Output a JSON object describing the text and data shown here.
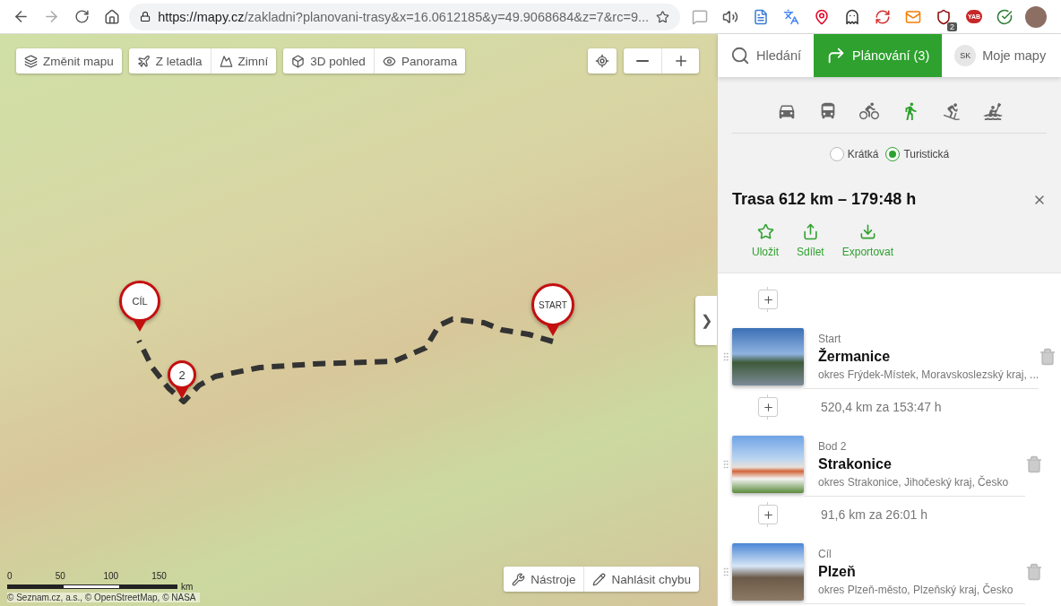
{
  "browser": {
    "url_host": "https://mapy.cz",
    "url_path": "/zakladni?planovani-trasy&x=16.0612185&y=49.9068684&z=7&rc=9...",
    "extensions": [
      {
        "kind": "chat"
      },
      {
        "kind": "speaker"
      },
      {
        "kind": "note"
      },
      {
        "kind": "translate"
      },
      {
        "kind": "pin"
      },
      {
        "kind": "ghost"
      },
      {
        "kind": "sync"
      },
      {
        "kind": "mail"
      },
      {
        "kind": "shield",
        "badge": "2"
      },
      {
        "kind": "tag",
        "text": "YAB"
      },
      {
        "kind": "check"
      }
    ]
  },
  "map": {
    "toolbar": [
      [
        {
          "kind": "layers",
          "label": "Změnit mapu"
        }
      ],
      [
        {
          "kind": "plane",
          "label": "Z letadla"
        },
        {
          "kind": "mountain",
          "label": "Zimní"
        }
      ],
      [
        {
          "kind": "cube",
          "label": "3D pohled"
        },
        {
          "kind": "eye",
          "label": "Panorama"
        }
      ]
    ],
    "markers": [
      {
        "kind": "end",
        "label": "CÍL"
      },
      {
        "kind": "via",
        "label": "2"
      },
      {
        "kind": "start",
        "label": "START"
      }
    ],
    "scale": {
      "ticks": [
        "0",
        "50",
        "100",
        "150"
      ],
      "unit": "km"
    },
    "attribution": "© Seznam.cz, a.s., © OpenStreetMap, © NASA",
    "bottom_buttons": [
      {
        "kind": "tools",
        "label": "Nástroje"
      },
      {
        "kind": "pencil",
        "label": "Nahlásit chybu"
      }
    ],
    "panel_toggle": "❯"
  },
  "panel": {
    "tabs": [
      {
        "kind": "search",
        "label": "Hledání",
        "selected": false
      },
      {
        "kind": "route",
        "label": "Plánování (3)",
        "selected": true
      },
      {
        "kind": "user",
        "avatar": "SK",
        "label": "Moje mapy",
        "selected": false
      }
    ],
    "modes": [
      {
        "kind": "car",
        "selected": false
      },
      {
        "kind": "bus",
        "selected": false
      },
      {
        "kind": "bike",
        "selected": false
      },
      {
        "kind": "walk",
        "selected": true
      },
      {
        "kind": "ski",
        "selected": false
      },
      {
        "kind": "boat",
        "selected": false
      }
    ],
    "route_types": [
      {
        "label": "Krátká",
        "selected": false
      },
      {
        "label": "Turistická",
        "selected": true
      }
    ],
    "route_title": "Trasa 612 km – 179:48 h",
    "actions": [
      {
        "kind": "star",
        "label": "Uložit"
      },
      {
        "kind": "share",
        "label": "Sdílet"
      },
      {
        "kind": "download",
        "label": "Exportovat"
      }
    ],
    "stops": [
      {
        "role": "Start",
        "name": "Žermanice",
        "region": "okres Frýdek-Místek, Moravskoslezský kraj, ..."
      },
      {
        "role": "Bod 2",
        "name": "Strakonice",
        "region": "okres Strakonice, Jihočeský kraj, Česko"
      },
      {
        "role": "Cíl",
        "name": "Plzeň",
        "region": "okres Plzeň-město, Plzeňský kraj, Česko"
      }
    ],
    "legs": [
      "520,4 km za 153:47 h",
      "91,6 km za 26:01 h"
    ]
  }
}
